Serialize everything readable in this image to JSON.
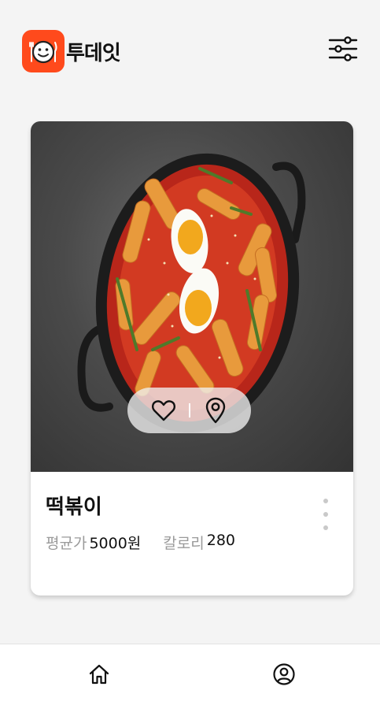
{
  "header": {
    "app_name": "투데잇",
    "logo_icon": "face-with-utensils-icon",
    "filter_icon": "sliders-icon"
  },
  "card": {
    "image_icon": "tteokbokki-photo",
    "name": "떡볶이",
    "price_label": "평균가",
    "price_value": "5000원",
    "calorie_label": "칼로리",
    "calorie_value": "280",
    "actions": {
      "like_icon": "heart-icon",
      "location_icon": "map-pin-icon"
    },
    "more_icon": "more-vertical-icon"
  },
  "bottom_nav": {
    "items": [
      {
        "icon": "home-icon"
      },
      {
        "icon": "user-profile-icon"
      }
    ]
  },
  "colors": {
    "brand": "#ff4a1c",
    "background": "#f4f4f4",
    "muted_text": "#9a9a9a"
  }
}
